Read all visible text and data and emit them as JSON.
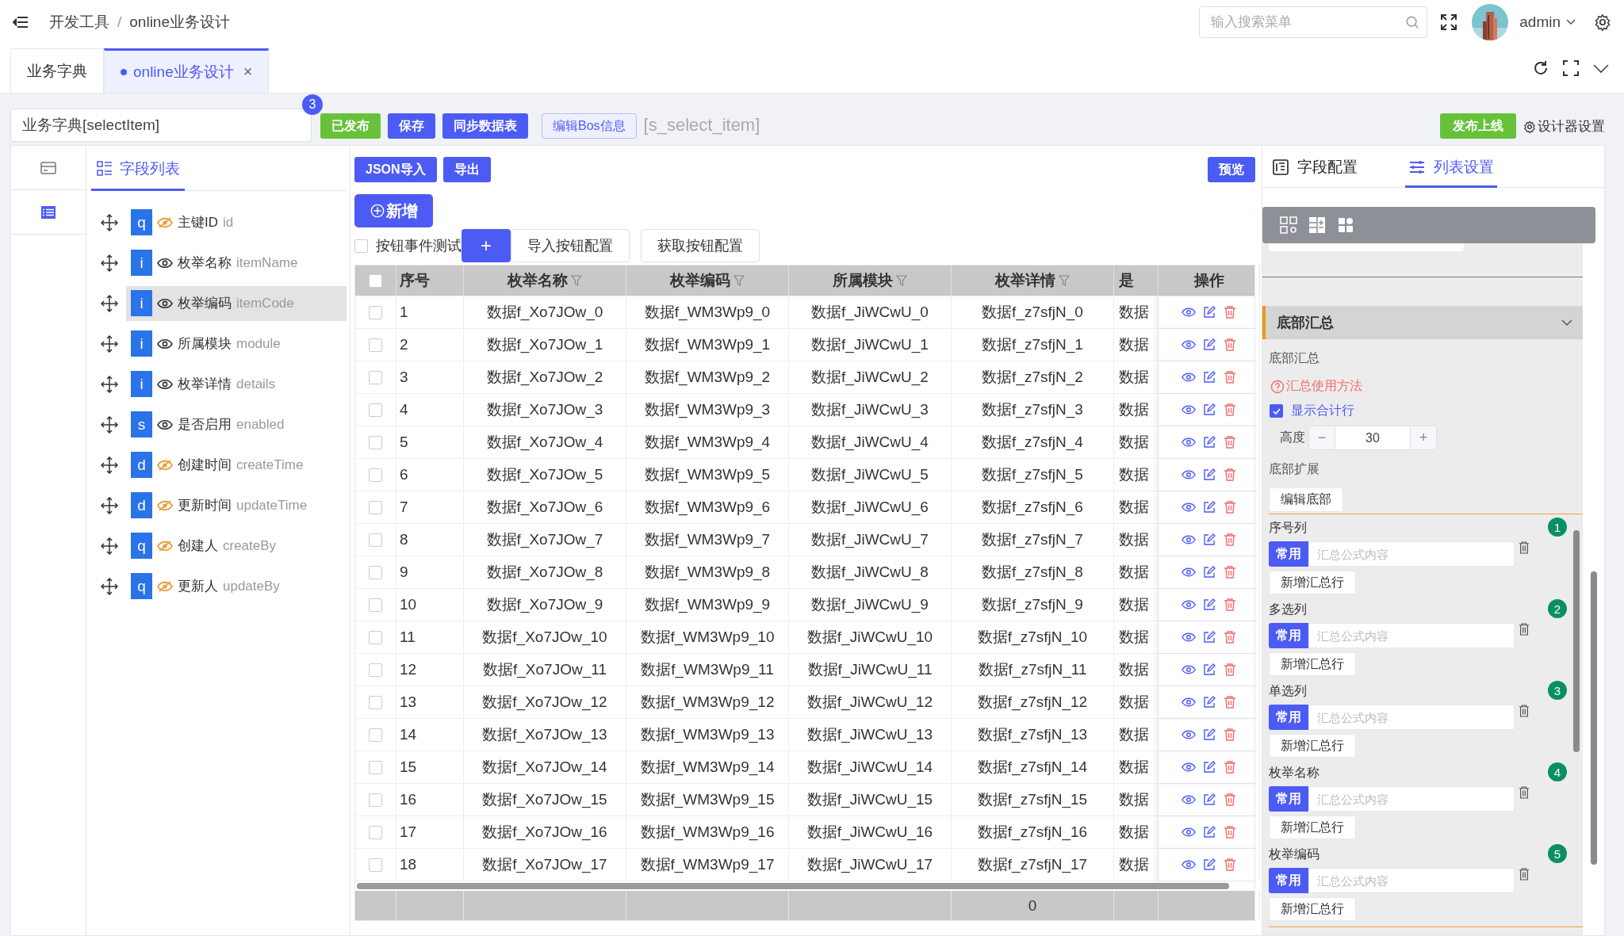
{
  "header": {
    "breadcrumb": [
      "开发工具",
      "online业务设计"
    ],
    "separator": "/",
    "search": {
      "placeholder": "输入搜索菜单"
    },
    "user": "admin"
  },
  "tabs": [
    {
      "label": "业务字典",
      "selected": false,
      "closable": false
    },
    {
      "label": "online业务设计",
      "selected": true,
      "closable": true,
      "close": "×"
    }
  ],
  "toolbar": {
    "name_field": "业务字典[selectItem]",
    "badge": "3",
    "buttons": [
      {
        "label": "已发布",
        "kind": "success"
      },
      {
        "label": "保存",
        "kind": "primary"
      },
      {
        "label": "同步数据表",
        "kind": "primary"
      },
      {
        "label": "编辑Bos信息",
        "kind": "plain"
      }
    ],
    "table_name": "[s_select_item]",
    "publish": "发布上线",
    "settings": "设计器设置"
  },
  "side_icons": [
    {
      "kind": "card",
      "selected": false
    },
    {
      "kind": "list",
      "selected": true
    }
  ],
  "field_panel": {
    "tab": "字段列表",
    "fields": [
      {
        "type": "q",
        "label": "主键ID",
        "code": "id",
        "visible": false,
        "selected": false
      },
      {
        "type": "i",
        "label": "枚举名称",
        "code": "itemName",
        "visible": true,
        "selected": false
      },
      {
        "type": "i",
        "label": "枚举编码",
        "code": "itemCode",
        "visible": true,
        "selected": true
      },
      {
        "type": "i",
        "label": "所属模块",
        "code": "module",
        "visible": true,
        "selected": false
      },
      {
        "type": "i",
        "label": "枚举详情",
        "code": "details",
        "visible": true,
        "selected": false
      },
      {
        "type": "s",
        "label": "是否启用",
        "code": "enabled",
        "visible": true,
        "selected": false
      },
      {
        "type": "d",
        "label": "创建时间",
        "code": "createTime",
        "visible": false,
        "selected": false
      },
      {
        "type": "d",
        "label": "更新时间",
        "code": "updateTime",
        "visible": false,
        "selected": false
      },
      {
        "type": "q",
        "label": "创建人",
        "code": "createBy",
        "visible": false,
        "selected": false
      },
      {
        "type": "q",
        "label": "更新人",
        "code": "updateBy",
        "visible": false,
        "selected": false
      }
    ]
  },
  "table_toolbar": {
    "buttons": [
      "JSON导入",
      "导出"
    ],
    "preview": "预览",
    "add": "新增",
    "test_checkbox": {
      "label": "按钮事件测试",
      "checked": false
    },
    "plus": "+",
    "config_buttons": [
      "导入按钮配置",
      "获取按钮配置"
    ]
  },
  "table": {
    "header_checked": false,
    "columns": [
      {
        "label": "序号",
        "filter": false
      },
      {
        "label": "枚举名称",
        "filter": true
      },
      {
        "label": "枚举编码",
        "filter": true
      },
      {
        "label": "所属模块",
        "filter": true
      },
      {
        "label": "枚举详情",
        "filter": true,
        "total": "0"
      },
      {
        "label": "是",
        "filter": false
      },
      {
        "label": "操作",
        "filter": false
      }
    ],
    "rows": [
      {
        "checked": false,
        "cells": [
          "1",
          "数据f_Xo7JOw_0",
          "数据f_WM3Wp9_0",
          "数据f_JiWCwU_0",
          "数据f_z7sfjN_0",
          "数据"
        ]
      },
      {
        "checked": false,
        "cells": [
          "2",
          "数据f_Xo7JOw_1",
          "数据f_WM3Wp9_1",
          "数据f_JiWCwU_1",
          "数据f_z7sfjN_1",
          "数据"
        ]
      },
      {
        "checked": false,
        "cells": [
          "3",
          "数据f_Xo7JOw_2",
          "数据f_WM3Wp9_2",
          "数据f_JiWCwU_2",
          "数据f_z7sfjN_2",
          "数据"
        ]
      },
      {
        "checked": false,
        "cells": [
          "4",
          "数据f_Xo7JOw_3",
          "数据f_WM3Wp9_3",
          "数据f_JiWCwU_3",
          "数据f_z7sfjN_3",
          "数据"
        ]
      },
      {
        "checked": false,
        "cells": [
          "5",
          "数据f_Xo7JOw_4",
          "数据f_WM3Wp9_4",
          "数据f_JiWCwU_4",
          "数据f_z7sfjN_4",
          "数据"
        ]
      },
      {
        "checked": false,
        "cells": [
          "6",
          "数据f_Xo7JOw_5",
          "数据f_WM3Wp9_5",
          "数据f_JiWCwU_5",
          "数据f_z7sfjN_5",
          "数据"
        ]
      },
      {
        "checked": false,
        "cells": [
          "7",
          "数据f_Xo7JOw_6",
          "数据f_WM3Wp9_6",
          "数据f_JiWCwU_6",
          "数据f_z7sfjN_6",
          "数据"
        ]
      },
      {
        "checked": false,
        "cells": [
          "8",
          "数据f_Xo7JOw_7",
          "数据f_WM3Wp9_7",
          "数据f_JiWCwU_7",
          "数据f_z7sfjN_7",
          "数据"
        ]
      },
      {
        "checked": false,
        "cells": [
          "9",
          "数据f_Xo7JOw_8",
          "数据f_WM3Wp9_8",
          "数据f_JiWCwU_8",
          "数据f_z7sfjN_8",
          "数据"
        ]
      },
      {
        "checked": false,
        "cells": [
          "10",
          "数据f_Xo7JOw_9",
          "数据f_WM3Wp9_9",
          "数据f_JiWCwU_9",
          "数据f_z7sfjN_9",
          "数据"
        ]
      },
      {
        "checked": false,
        "cells": [
          "11",
          "数据f_Xo7JOw_10",
          "数据f_WM3Wp9_10",
          "数据f_JiWCwU_10",
          "数据f_z7sfjN_10",
          "数据"
        ]
      },
      {
        "checked": false,
        "cells": [
          "12",
          "数据f_Xo7JOw_11",
          "数据f_WM3Wp9_11",
          "数据f_JiWCwU_11",
          "数据f_z7sfjN_11",
          "数据"
        ]
      },
      {
        "checked": false,
        "cells": [
          "13",
          "数据f_Xo7JOw_12",
          "数据f_WM3Wp9_12",
          "数据f_JiWCwU_12",
          "数据f_z7sfjN_12",
          "数据"
        ]
      },
      {
        "checked": false,
        "cells": [
          "14",
          "数据f_Xo7JOw_13",
          "数据f_WM3Wp9_13",
          "数据f_JiWCwU_13",
          "数据f_z7sfjN_13",
          "数据"
        ]
      },
      {
        "checked": false,
        "cells": [
          "15",
          "数据f_Xo7JOw_14",
          "数据f_WM3Wp9_14",
          "数据f_JiWCwU_14",
          "数据f_z7sfjN_14",
          "数据"
        ]
      },
      {
        "checked": false,
        "cells": [
          "16",
          "数据f_Xo7JOw_15",
          "数据f_WM3Wp9_15",
          "数据f_JiWCwU_15",
          "数据f_z7sfjN_15",
          "数据"
        ]
      },
      {
        "checked": false,
        "cells": [
          "17",
          "数据f_Xo7JOw_16",
          "数据f_WM3Wp9_16",
          "数据f_JiWCwU_16",
          "数据f_z7sfjN_16",
          "数据"
        ]
      },
      {
        "checked": false,
        "cells": [
          "18",
          "数据f_Xo7JOw_17",
          "数据f_WM3Wp9_17",
          "数据f_JiWCwU_17",
          "数据f_z7sfjN_17",
          "数据"
        ]
      }
    ]
  },
  "right_panel": {
    "tabs": [
      {
        "label": "字段配置",
        "selected": false
      },
      {
        "label": "列表设置",
        "selected": true
      }
    ],
    "section": {
      "title": "底部汇总",
      "expanded": true
    },
    "summary_label": "底部汇总",
    "help_link": "汇总使用方法",
    "show_total": {
      "label": "显示合计行",
      "checked": true
    },
    "height": {
      "label": "高度",
      "value": "30",
      "minus": "−",
      "plus": "+"
    },
    "extension_label": "底部扩展",
    "edit_footer": "编辑底部",
    "summary_rows": [
      {
        "index": "1",
        "label": "序号列",
        "tag": "常用",
        "placeholder": "汇总公式内容",
        "add": "新增汇总行"
      },
      {
        "index": "2",
        "label": "多选列",
        "tag": "常用",
        "placeholder": "汇总公式内容",
        "add": "新增汇总行"
      },
      {
        "index": "3",
        "label": "单选列",
        "tag": "常用",
        "placeholder": "汇总公式内容",
        "add": "新增汇总行"
      },
      {
        "index": "4",
        "label": "枚举名称",
        "tag": "常用",
        "placeholder": "汇总公式内容",
        "add": "新增汇总行"
      },
      {
        "index": "5",
        "label": "枚举编码",
        "tag": "常用",
        "placeholder": "汇总公式内容",
        "add": "新增汇总行"
      }
    ]
  }
}
